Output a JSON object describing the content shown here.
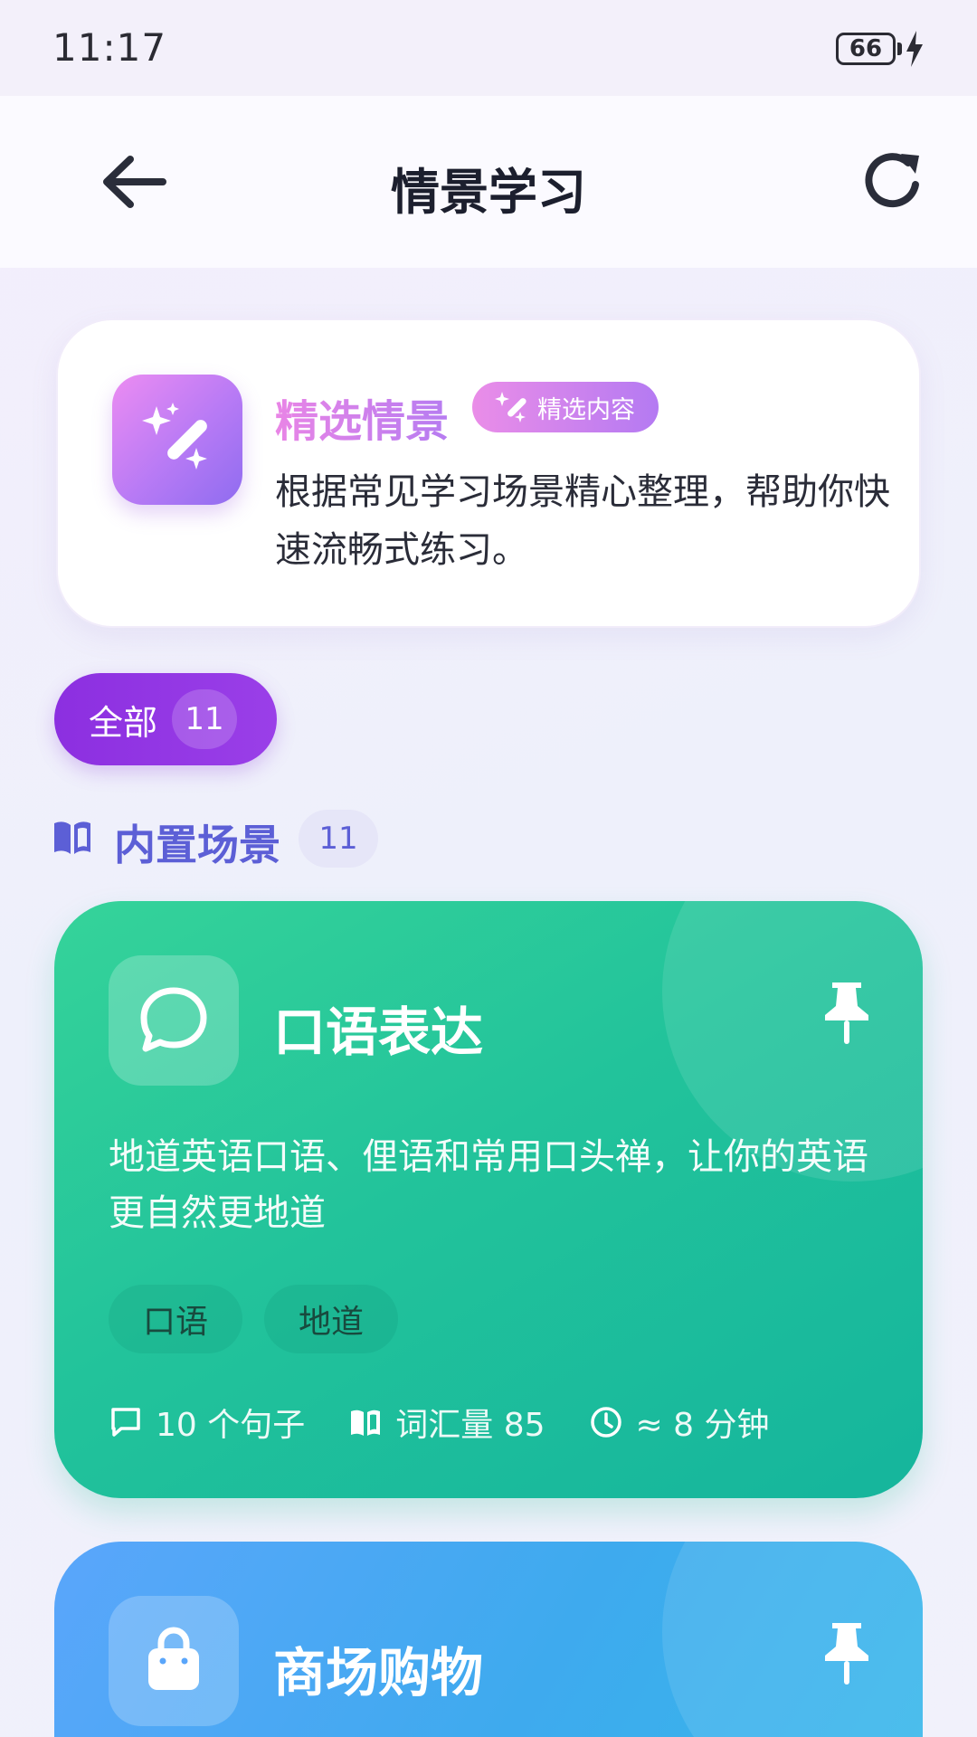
{
  "status_bar": {
    "time": "11:17",
    "battery": "66"
  },
  "header": {
    "title": "情景学习"
  },
  "featured": {
    "title": "精选情景",
    "badge": "精选内容",
    "description": "根据常见学习场景精心整理，帮助你快速流畅式练习。"
  },
  "filter": {
    "label": "全部",
    "count": "11"
  },
  "section": {
    "title": "内置场景",
    "count": "11"
  },
  "scenes": [
    {
      "title": "口语表达",
      "description": "地道英语口语、俚语和常用口头禅，让你的英语更自然更地道",
      "tags": [
        "口语",
        "地道"
      ],
      "stats": {
        "sentences": "10 个句子",
        "vocabulary": "词汇量 85",
        "duration": "≈ 8 分钟"
      },
      "icon": "chat-bubble-icon",
      "color": "#22c39b"
    },
    {
      "title": "商场购物",
      "icon": "shopping-bag-icon",
      "color": "#3eaaee"
    }
  ]
}
